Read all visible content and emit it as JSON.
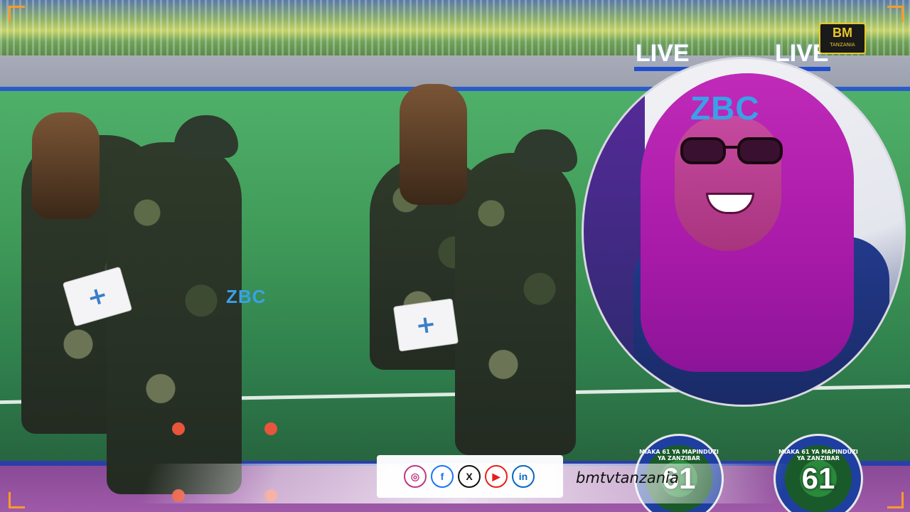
{
  "broadcaster": {
    "logo_text": "ZBC"
  },
  "live": {
    "label": "LIVE"
  },
  "channel_logo": {
    "text": "BM",
    "sub": "TANZANIA"
  },
  "medkit": {
    "symbol": "+"
  },
  "social": {
    "icons": [
      {
        "name": "instagram-icon",
        "glyph": "◎",
        "color": "#c13584"
      },
      {
        "name": "facebook-icon",
        "glyph": "f",
        "color": "#1877f2"
      },
      {
        "name": "x-icon",
        "glyph": "X",
        "color": "#111111"
      },
      {
        "name": "youtube-icon",
        "glyph": "▶",
        "color": "#e62117"
      },
      {
        "name": "linkedin-icon",
        "glyph": "in",
        "color": "#0a66c2"
      }
    ],
    "handle": "bmtvtanzania"
  },
  "emblem": {
    "number": "61",
    "arc_text": "MIAKA 61 YA MAPINDUZI YA ZANZIBAR"
  },
  "colors": {
    "frame_accent": "#ff9a2a",
    "live_underline": "#1f4fd0",
    "scarf": "#c02ab8"
  }
}
